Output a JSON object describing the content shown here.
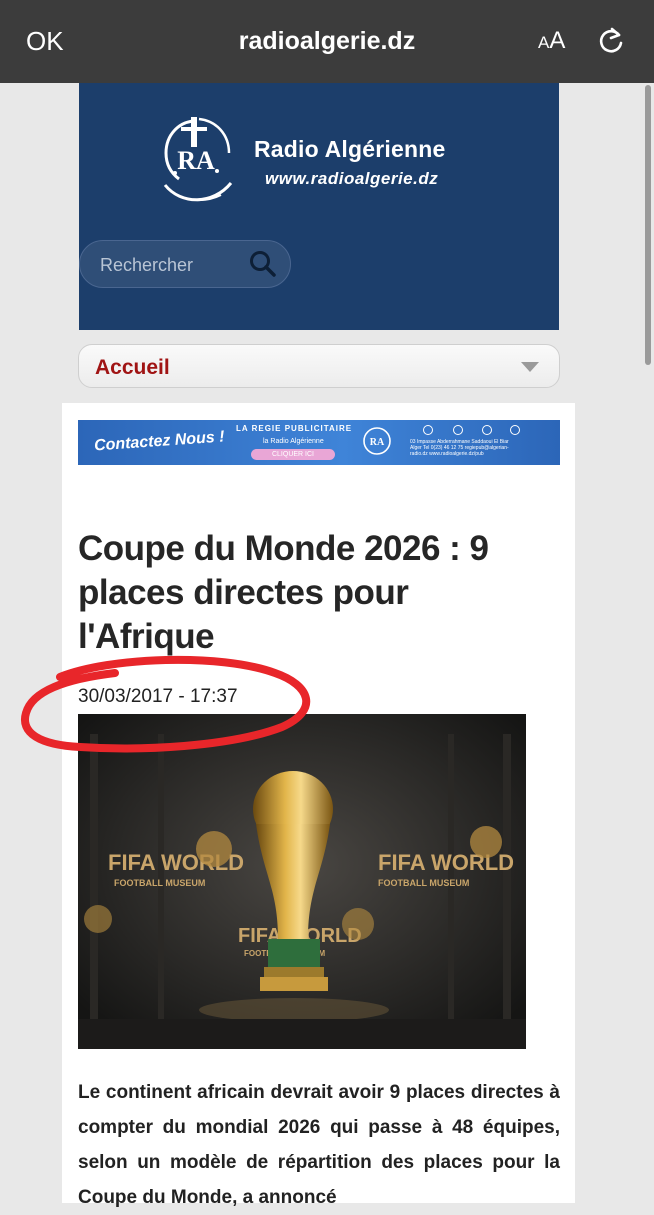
{
  "browser": {
    "done_label": "OK",
    "url": "radioalgerie.dz",
    "text_size_label": "AA",
    "reload_icon": "reload-icon"
  },
  "header": {
    "logo_title": "Radio Algérienne",
    "logo_url": "www.radioalgerie.dz",
    "logo_mark_text": "RA",
    "search_placeholder": "Rechercher",
    "background_color": "#1c3e6b"
  },
  "nav": {
    "selected": "Accueil"
  },
  "ad": {
    "cta": "Contactez Nous !",
    "regie": "LA REGIE PUBLICITAIRE",
    "radio": "la Radio Algérienne",
    "click": "CLIQUER ICI",
    "contact": "03 Impasse Abderrahmane Saddaoui El Biar Alger Tel 0(23) 46 12 75 regiepub@algerian-radio.dz www.radioalgerie.dz/pub"
  },
  "article": {
    "title": "Coupe du Monde 2026 : 9 places directes pour l'Afrique",
    "date": "30/03/2017 - 17:37",
    "image_alt": "FIFA World Cup trophy at FIFA World Football Museum",
    "image_caption_text": "FIFA WORLD FOOTBALL MUSEUM",
    "body": "Le continent africain devrait avoir 9 places directes à compter du mondial 2026 qui passe à 48 équipes, selon un modèle de répartition des places pour la Coupe du Monde, a annoncé"
  },
  "colors": {
    "accent_red": "#a01414",
    "annotation_red": "#e8262a"
  }
}
